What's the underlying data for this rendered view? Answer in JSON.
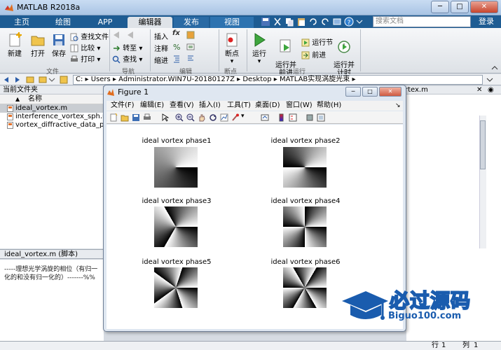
{
  "app": {
    "title": "MATLAB R2018a",
    "window_buttons": [
      "─",
      "□",
      "✕"
    ]
  },
  "tabs": [
    "主页",
    "绘图",
    "APP",
    "编辑器",
    "发布",
    "视图"
  ],
  "search": {
    "placeholder": "搜索文档"
  },
  "login": "登录",
  "ribbon": {
    "file": {
      "new": "新建",
      "open": "打开",
      "save": "保存",
      "find_files": "查找文件",
      "compare": "比较",
      "print": "打印",
      "group": "文件"
    },
    "nav": {
      "goto": "转至",
      "find": "查找",
      "group": "导航"
    },
    "edit": {
      "insert": "插入",
      "comment": "注释",
      "indent": "缩进",
      "fx": "fx",
      "group": "编辑"
    },
    "breakpoints": {
      "label": "断点",
      "group": "断点"
    },
    "run": {
      "run": "运行",
      "run_advance": "运行并\n前进",
      "run_section": "运行节",
      "advance": "前进",
      "run_time": "运行并\n计时",
      "group": "运行"
    }
  },
  "address": {
    "segments": [
      "C:",
      "Users",
      "Administrator.WIN7U-20180127Z",
      "Desktop",
      "MATLAB实现涡旋光束"
    ]
  },
  "current_folder": {
    "header": "当前文件夹",
    "column": "名称",
    "files": [
      "ideal_vortex.m",
      "interference_vortex_sph.m",
      "vortex_diffractive_data_pl"
    ]
  },
  "detail": {
    "header": "ideal_vortex.m  (脚本)",
    "lines": [
      "-----理想光学涡旋的相位（有归一",
      "化的和没有归一化的）-------%%"
    ]
  },
  "workspace": {
    "header": "rtex.m"
  },
  "status": {
    "row_label": "行",
    "row": "1",
    "col_label": "列",
    "col": "1"
  },
  "figure": {
    "title": "Figure 1",
    "menu": [
      "文件(F)",
      "编辑(E)",
      "查看(V)",
      "插入(I)",
      "工具(T)",
      "桌面(D)",
      "窗口(W)",
      "帮助(H)"
    ],
    "subplots": [
      {
        "title": "ideal vortex phase1",
        "charge": 1
      },
      {
        "title": "ideal vortex phase2",
        "charge": 2
      },
      {
        "title": "ideal vortex phase3",
        "charge": 3
      },
      {
        "title": "ideal vortex phase4",
        "charge": 4
      },
      {
        "title": "ideal vortex phase5",
        "charge": 5
      },
      {
        "title": "ideal vortex phase6",
        "charge": 6
      }
    ]
  },
  "watermark": {
    "big": "必过源码",
    "small": "Biguo100.com"
  }
}
